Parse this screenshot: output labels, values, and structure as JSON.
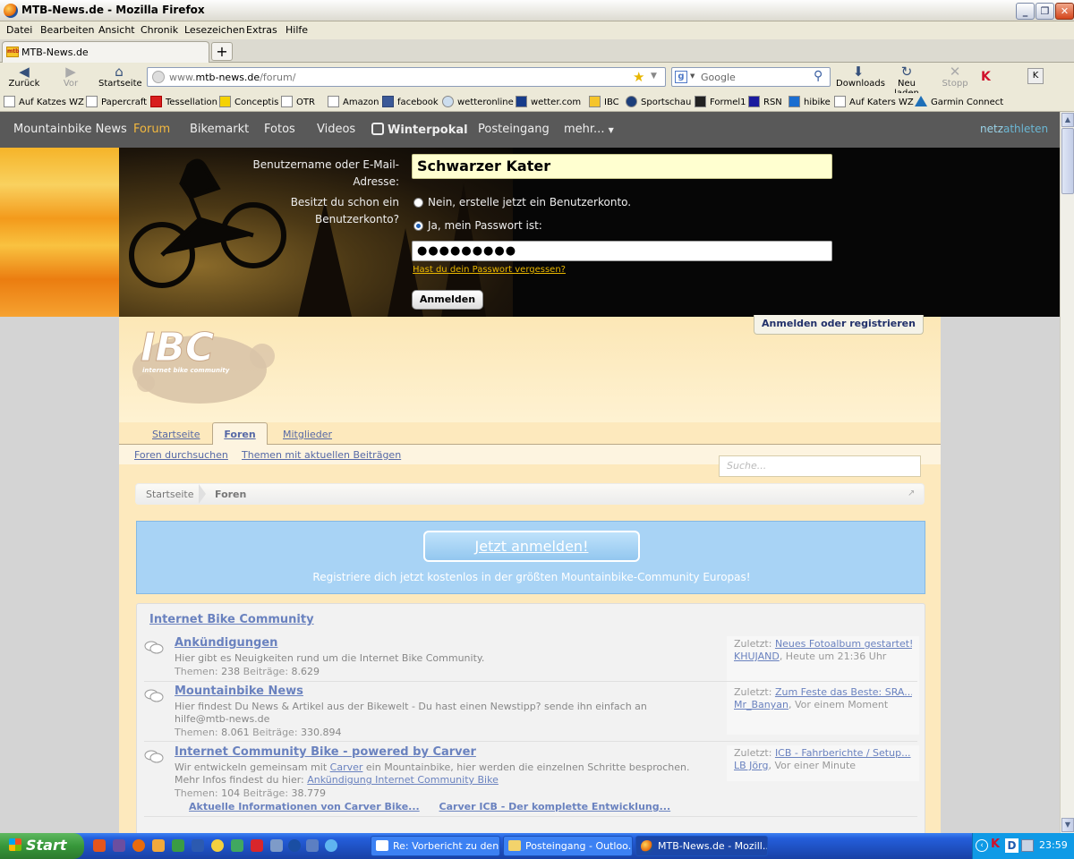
{
  "window": {
    "title": "MTB-News.de - Mozilla Firefox"
  },
  "menubar": {
    "items": [
      "Datei",
      "Bearbeiten",
      "Ansicht",
      "Chronik",
      "Lesezeichen",
      "Extras",
      "Hilfe"
    ]
  },
  "tab": {
    "label": "MTB-News.de",
    "new_tab_symbol": "+"
  },
  "navbar": {
    "back": "Zurück",
    "forward": "Vor",
    "home": "Startseite",
    "url_prefix": "www.",
    "url_domain": "mtb-news.de",
    "url_path": "/forum/",
    "search_engine_placeholder": "Google",
    "downloads": "Downloads",
    "reload": "Neu laden",
    "stop": "Stopp"
  },
  "bookmarks": [
    "Auf Katzes WZ",
    "Papercraft",
    "Tessellation",
    "Conceptis",
    "OTR",
    "Amazon",
    "facebook",
    "wetteronline",
    "wetter.com",
    "IBC",
    "Sportschau",
    "Formel1",
    "RSN",
    "hibike",
    "Auf Katers WZ",
    "Garmin Connect"
  ],
  "site_nav": {
    "items": [
      "Mountainbike News",
      "Forum",
      "Bikemarkt",
      "Fotos",
      "Videos",
      "Winterpokal",
      "Posteingang",
      "mehr..."
    ],
    "active": "Forum",
    "brand_left": "netz",
    "brand_right": "athleten"
  },
  "login": {
    "username_label": "Benutzername oder E-Mail-Adresse:",
    "username_value": "Schwarzer Kater",
    "account_question": "Besitzt du schon ein Benutzerkonto?",
    "option_no": "Nein, erstelle jetzt ein Benutzerkonto.",
    "option_yes": "Ja, mein Passwort ist:",
    "selected": "yes",
    "password_mask": "●●●●●●●●●",
    "forgot_link": "Hast du dein Passwort vergessen?",
    "submit": "Anmelden"
  },
  "site": {
    "login_register_tab": "Anmelden oder registrieren",
    "logo_text": "IBC",
    "logo_subtitle": "internet bike community",
    "tabs": [
      "Startseite",
      "Foren",
      "Mitglieder"
    ],
    "active_tab": "Foren",
    "subtabs": [
      "Foren durchsuchen",
      "Themen mit aktuellen Beiträgen"
    ],
    "search_placeholder": "Suche...",
    "breadcrumb": [
      "Startseite",
      "Foren"
    ]
  },
  "banner": {
    "button": "Jetzt anmelden!",
    "text": "Registriere dich jetzt kostenlos in der größten Mountainbike-Community Europas!"
  },
  "forum": {
    "category": "Internet Bike Community",
    "nodes": [
      {
        "title": "Ankündigungen",
        "desc": "Hier gibt es Neuigkeiten rund um die Internet Bike Community.",
        "themen_label": "Themen:",
        "themen": "238",
        "beitraege_label": "Beiträge:",
        "beitraege": "8.629",
        "last_label": "Zuletzt:",
        "last_title": "Neues Fotoalbum gestartet!",
        "last_user": "KHUJAND",
        "last_time": ", Heute um 21:36 Uhr"
      },
      {
        "title": "Mountainbike News",
        "desc": "Hier findest Du News & Artikel aus der Bikewelt - Du hast einen Newstipp? sende ihn einfach an hilfe@mtb-news.de",
        "themen_label": "Themen:",
        "themen": "8.061",
        "beitraege_label": "Beiträge:",
        "beitraege": "330.894",
        "last_label": "Zuletzt:",
        "last_title": "Zum Feste das Beste: SRA...",
        "last_user": "Mr_Banyan",
        "last_time": ", Vor einem Moment"
      },
      {
        "title": "Internet Community Bike - powered by Carver",
        "desc_part1": "Wir entwickeln gemeinsam mit ",
        "desc_link1": "Carver",
        "desc_part2": " ein Mountainbike, hier werden die einzelnen Schritte besprochen.",
        "desc_part3": "Mehr Infos findest du hier: ",
        "desc_link2": "Ankündigung Internet Community Bike",
        "themen_label": "Themen:",
        "themen": "104",
        "beitraege_label": "Beiträge:",
        "beitraege": "38.779",
        "last_label": "Zuletzt:",
        "last_title": "ICB - Fahrberichte / Setup...",
        "last_user": "LB Jörg",
        "last_time": ", Vor einer Minute",
        "sublinks": [
          "Aktuelle Informationen von Carver Bike...",
          "Carver ICB - Der komplette Entwicklung..."
        ]
      }
    ]
  },
  "taskbar": {
    "start": "Start",
    "tasks": [
      "Re: Vorbericht zu den...",
      "Posteingang - Outloo...",
      "MTB-News.de - Mozill..."
    ],
    "active_task": 2,
    "clock": "23:59"
  },
  "colors": {
    "link": "#6a82bf",
    "nav_bg": "#595959",
    "nav_active": "#f2b83f",
    "banner_bg": "#a8d3f5",
    "site_bg": "#fde9bd",
    "xp_blue": "#245edb",
    "xp_start_green": "#37973a"
  }
}
